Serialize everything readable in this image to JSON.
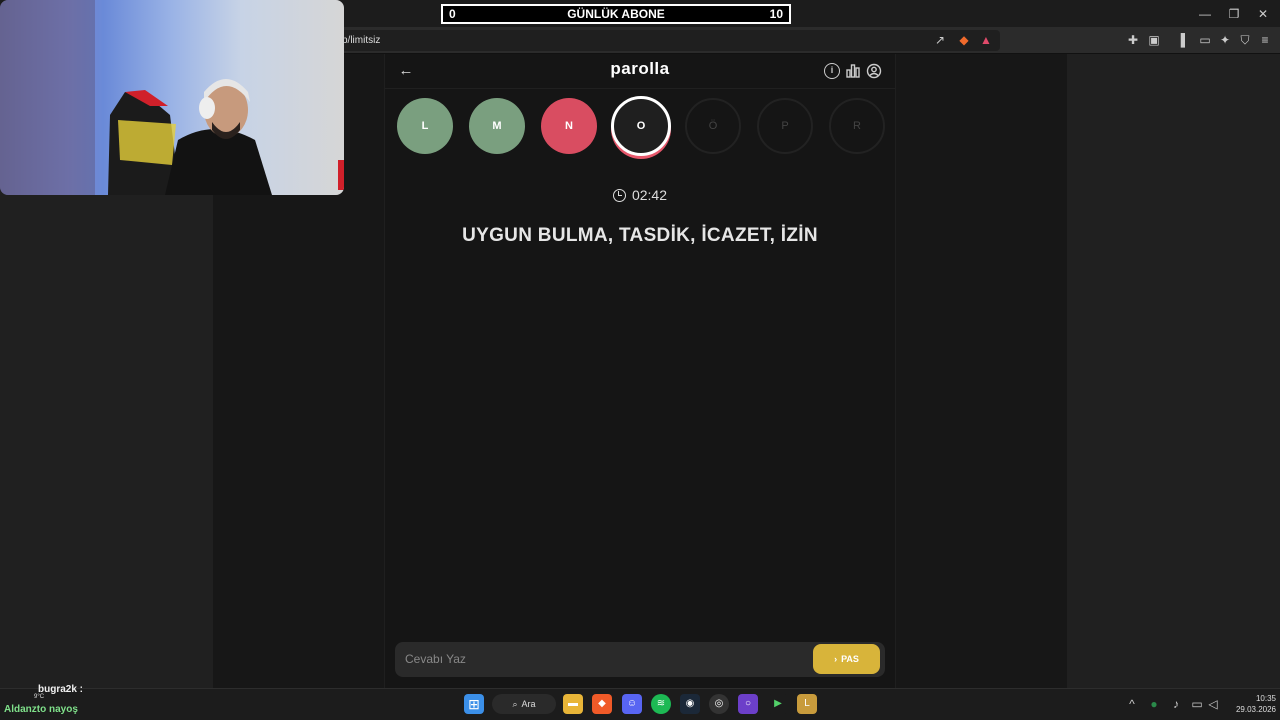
{
  "stream_overlay": {
    "counter_left": "0",
    "counter_title": "GÜNLÜK ABONE",
    "counter_right": "10",
    "chat_user": "bugra2k :",
    "chat_names": "Aldanzto nayoş",
    "weather": "9°C"
  },
  "browser": {
    "url_fragment": "p/limitsiz"
  },
  "app": {
    "title": "parolla",
    "letters": [
      {
        "char": "L",
        "state": "correct"
      },
      {
        "char": "M",
        "state": "correct"
      },
      {
        "char": "N",
        "state": "wrong"
      },
      {
        "char": "O",
        "state": "active"
      },
      {
        "char": "Ö",
        "state": "pending"
      },
      {
        "char": "P",
        "state": "pending"
      },
      {
        "char": "R",
        "state": "pending"
      }
    ],
    "timer": "02:42",
    "clue": "UYGUN BULMA, TASDİK, İCAZET, İZİN",
    "answer_placeholder": "Cevabı Yaz",
    "pass_label": "PAS"
  },
  "colors": {
    "correct": "#7a9f7f",
    "wrong": "#d94d61",
    "pass_button": "#d8b43a"
  },
  "taskbar": {
    "search_label": "Ara",
    "time": "10:35",
    "date": "29.03.2026"
  }
}
